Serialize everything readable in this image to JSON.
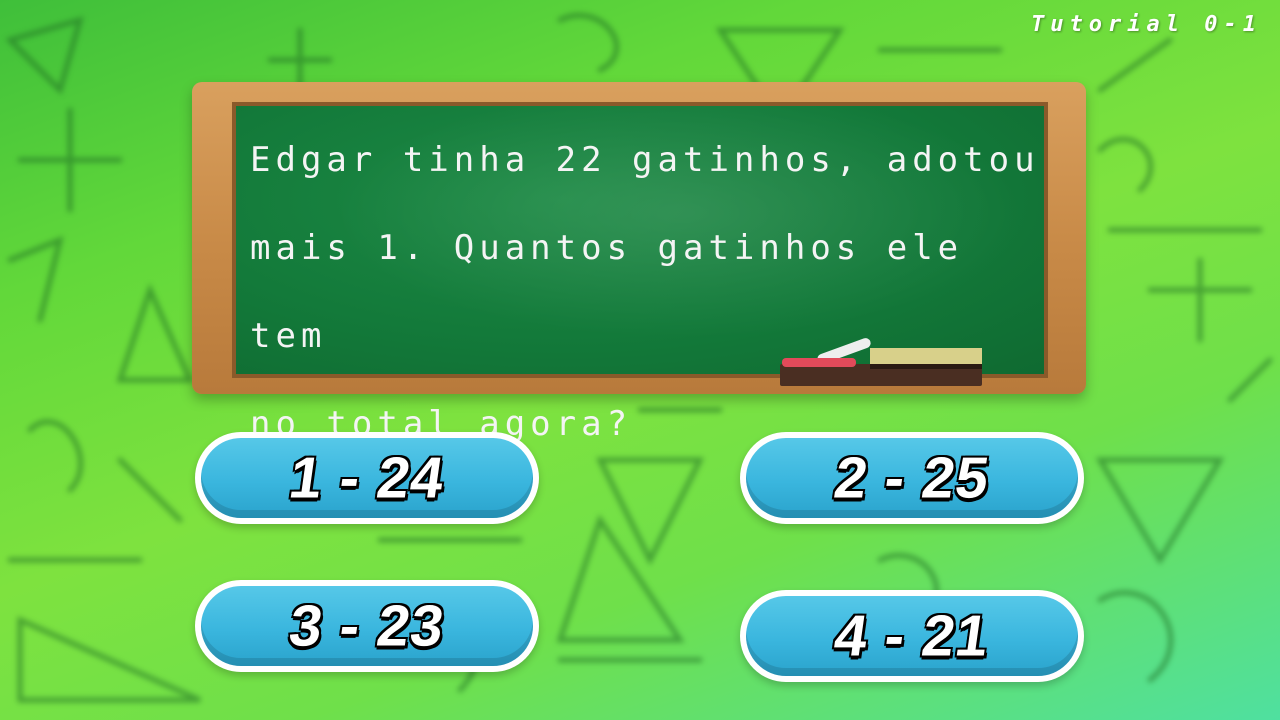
{
  "level": "Tutorial 0-1",
  "question": {
    "text": "Edgar tinha 22 gatinhos, adotou mais 1. Quantos gatinhos ele tem no total agora?",
    "line1": "Edgar tinha 22 gatinhos, adotou",
    "line2": "mais 1. Quantos gatinhos ele tem",
    "line3": "no total agora?"
  },
  "answers": [
    {
      "label": "1 - 24"
    },
    {
      "label": "2 - 25"
    },
    {
      "label": "3 - 23"
    },
    {
      "label": "4 - 21"
    }
  ],
  "colors": {
    "board": "#137a3a",
    "frame": "#c98b48",
    "button": "#3ab6de",
    "background": "#6fe04a"
  }
}
